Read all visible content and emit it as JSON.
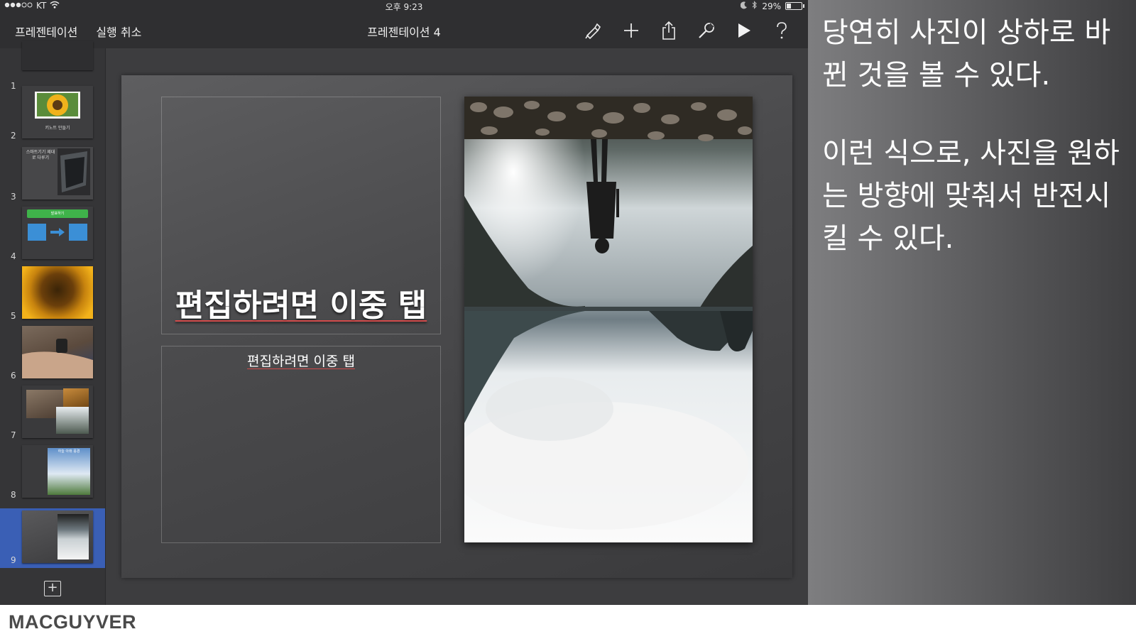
{
  "status_bar": {
    "carrier": "KT",
    "time": "오후 9:23",
    "battery_percent": "29%",
    "battery_level": 0.29
  },
  "toolbar": {
    "back_label": "프레젠테이션",
    "undo_label": "실행 취소",
    "doc_title": "프레젠테이션 4",
    "icons": [
      "format-brush-icon",
      "plus-icon",
      "share-icon",
      "wrench-icon",
      "play-icon",
      "help-icon"
    ]
  },
  "navigator": {
    "slides": [
      {
        "number": "1"
      },
      {
        "number": "2",
        "caption": "키노트 만들기"
      },
      {
        "number": "3",
        "caption": "스마트기기 제대로 다루기"
      },
      {
        "number": "4",
        "caption": "발표하기"
      },
      {
        "number": "5"
      },
      {
        "number": "6"
      },
      {
        "number": "7"
      },
      {
        "number": "8",
        "caption": "하늘 아래 풍경"
      },
      {
        "number": "9",
        "selected": true
      }
    ],
    "selected_color": "#3a5fb5"
  },
  "slide": {
    "title_placeholder": "편집하려면 이중 탭",
    "body_placeholder": "편집하려면 이중 탭"
  },
  "annotation": {
    "paragraph1": "당연히 사진이 상하로 바뀐 것을 볼 수 있다.",
    "paragraph2": "이런 식으로, 사진을 원하는 방향에 맞춰서 반전시킬 수 있다."
  },
  "footer": {
    "brand": "MACGUYVER"
  }
}
